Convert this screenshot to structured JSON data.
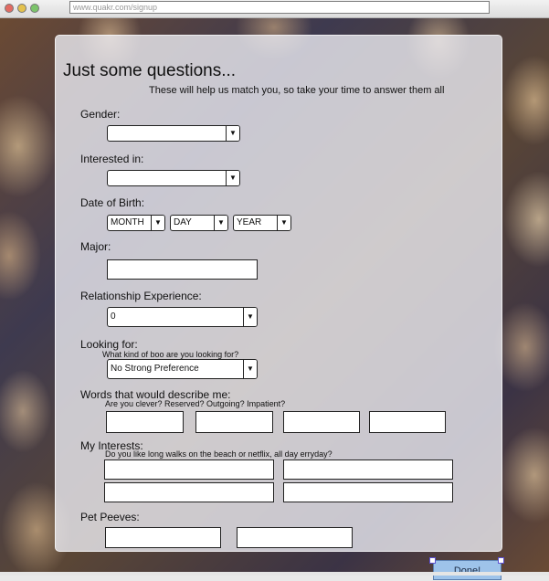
{
  "browser": {
    "url": "www.quakr.com/signup"
  },
  "form": {
    "title": "Just some questions...",
    "subtitle": "These will help us match you, so take your time to answer them all",
    "gender": {
      "label": "Gender:",
      "value": ""
    },
    "interested_in": {
      "label": "Interested in:",
      "value": ""
    },
    "dob": {
      "label": "Date of Birth:",
      "month": "MONTH",
      "day": "DAY",
      "year": "YEAR"
    },
    "major": {
      "label": "Major:",
      "value": ""
    },
    "relationship_experience": {
      "label": "Relationship Experience:",
      "value": "0"
    },
    "looking_for": {
      "label": "Looking for:",
      "hint": "What kind of boo are you looking for?",
      "value": "No Strong Preference"
    },
    "words": {
      "label": "Words that would describe me:",
      "hint": "Are you clever? Reserved? Outgoing? Impatient?"
    },
    "interests": {
      "label": "My Interests:",
      "hint": "Do you like long walks on the beach or netflix, all day erryday?"
    },
    "pet_peeves": {
      "label": "Pet Peeves:"
    },
    "done_label": "Done!"
  },
  "arrow_glyph": "▼"
}
